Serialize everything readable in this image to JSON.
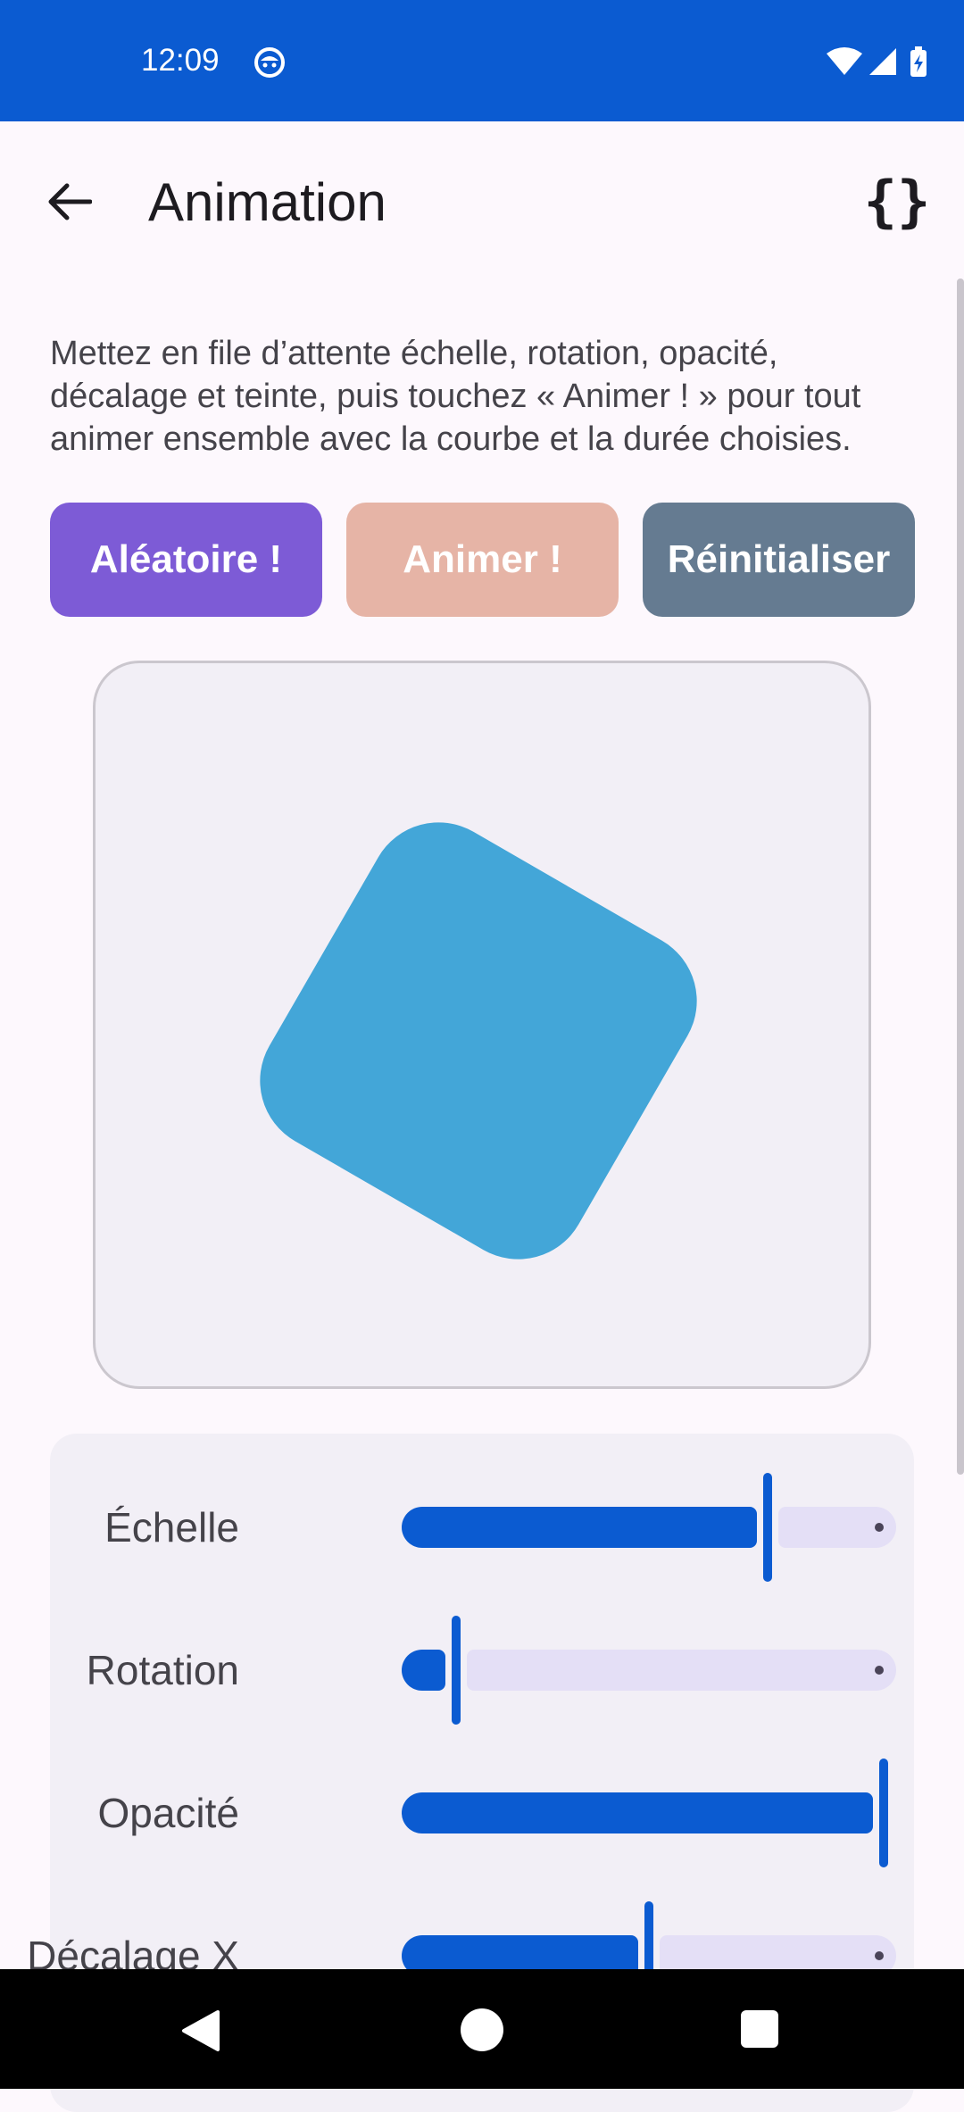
{
  "status_bar": {
    "time": "12:09"
  },
  "app_bar": {
    "title": "Animation"
  },
  "description": "Mettez en file d’attente échelle, rotation, opacité, décalage et teinte, puis touchez « Animer ! » pour tout animer ensemble avec la courbe et la durée choisies.",
  "buttons": {
    "random": "Aléatoire !",
    "animate": "Animer !",
    "reset": "Réinitialiser"
  },
  "colors": {
    "primary": "#0b5bd1",
    "random_button": "#7d5bd6",
    "animate_button": "#e6b4a6",
    "reset_button": "#657b91",
    "shape": "#43a6d8"
  },
  "sliders": [
    {
      "label": "Échelle",
      "fraction": 0.74
    },
    {
      "label": "Rotation",
      "fraction": 0.11
    },
    {
      "label": "Opacité",
      "fraction": 1.0
    },
    {
      "label": "Décalage X",
      "fraction": 0.5
    }
  ]
}
